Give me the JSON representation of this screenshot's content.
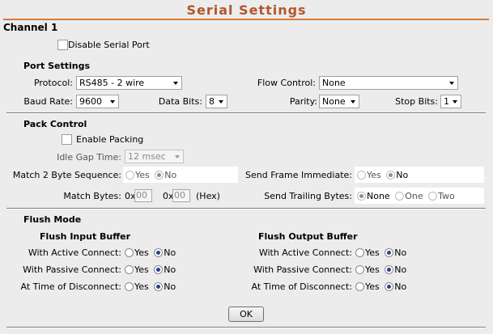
{
  "title": "Serial Settings",
  "channel": "Channel 1",
  "disable_serial_port": {
    "label": "Disable Serial Port",
    "checked": false
  },
  "port": {
    "heading": "Port Settings",
    "protocol": {
      "label": "Protocol:",
      "value": "RS485 - 2 wire"
    },
    "flow_control": {
      "label": "Flow Control:",
      "value": "None"
    },
    "baud_rate": {
      "label": "Baud Rate:",
      "value": "9600"
    },
    "data_bits": {
      "label": "Data Bits:",
      "value": "8"
    },
    "parity": {
      "label": "Parity:",
      "value": "None"
    },
    "stop_bits": {
      "label": "Stop Bits:",
      "value": "1"
    }
  },
  "pack": {
    "heading": "Pack Control",
    "enable_packing": {
      "label": "Enable Packing",
      "checked": false
    },
    "idle_gap": {
      "label": "Idle Gap Time:",
      "value": "12 msec"
    },
    "match2": {
      "label": "Match 2 Byte Sequence:",
      "yes": "Yes",
      "no": "No",
      "selected": "No"
    },
    "send_frame": {
      "label": "Send Frame Immediate:",
      "yes": "Yes",
      "no": "No",
      "selected": "No"
    },
    "match_bytes": {
      "label": "Match Bytes:",
      "prefix1": "0x",
      "value1": "00",
      "prefix2": "0x",
      "value2": "00",
      "suffix": "(Hex)"
    },
    "send_trailing": {
      "label": "Send Trailing Bytes:",
      "options": [
        "None",
        "One",
        "Two"
      ],
      "selected": "None"
    }
  },
  "flush": {
    "heading": "Flush Mode",
    "input": {
      "heading": "Flush Input Buffer",
      "active": {
        "label": "With Active Connect:",
        "selected": "No"
      },
      "passive": {
        "label": "With Passive Connect:",
        "selected": "No"
      },
      "disconnect": {
        "label": "At Time of Disconnect:",
        "selected": "No"
      }
    },
    "output": {
      "heading": "Flush Output Buffer",
      "active": {
        "label": "With Active Connect:",
        "selected": "No"
      },
      "passive": {
        "label": "With Passive Connect:",
        "selected": "No"
      },
      "disconnect": {
        "label": "At Time of Disconnect:",
        "selected": "No"
      }
    },
    "yes": "Yes",
    "no": "No"
  },
  "ok_label": "OK"
}
